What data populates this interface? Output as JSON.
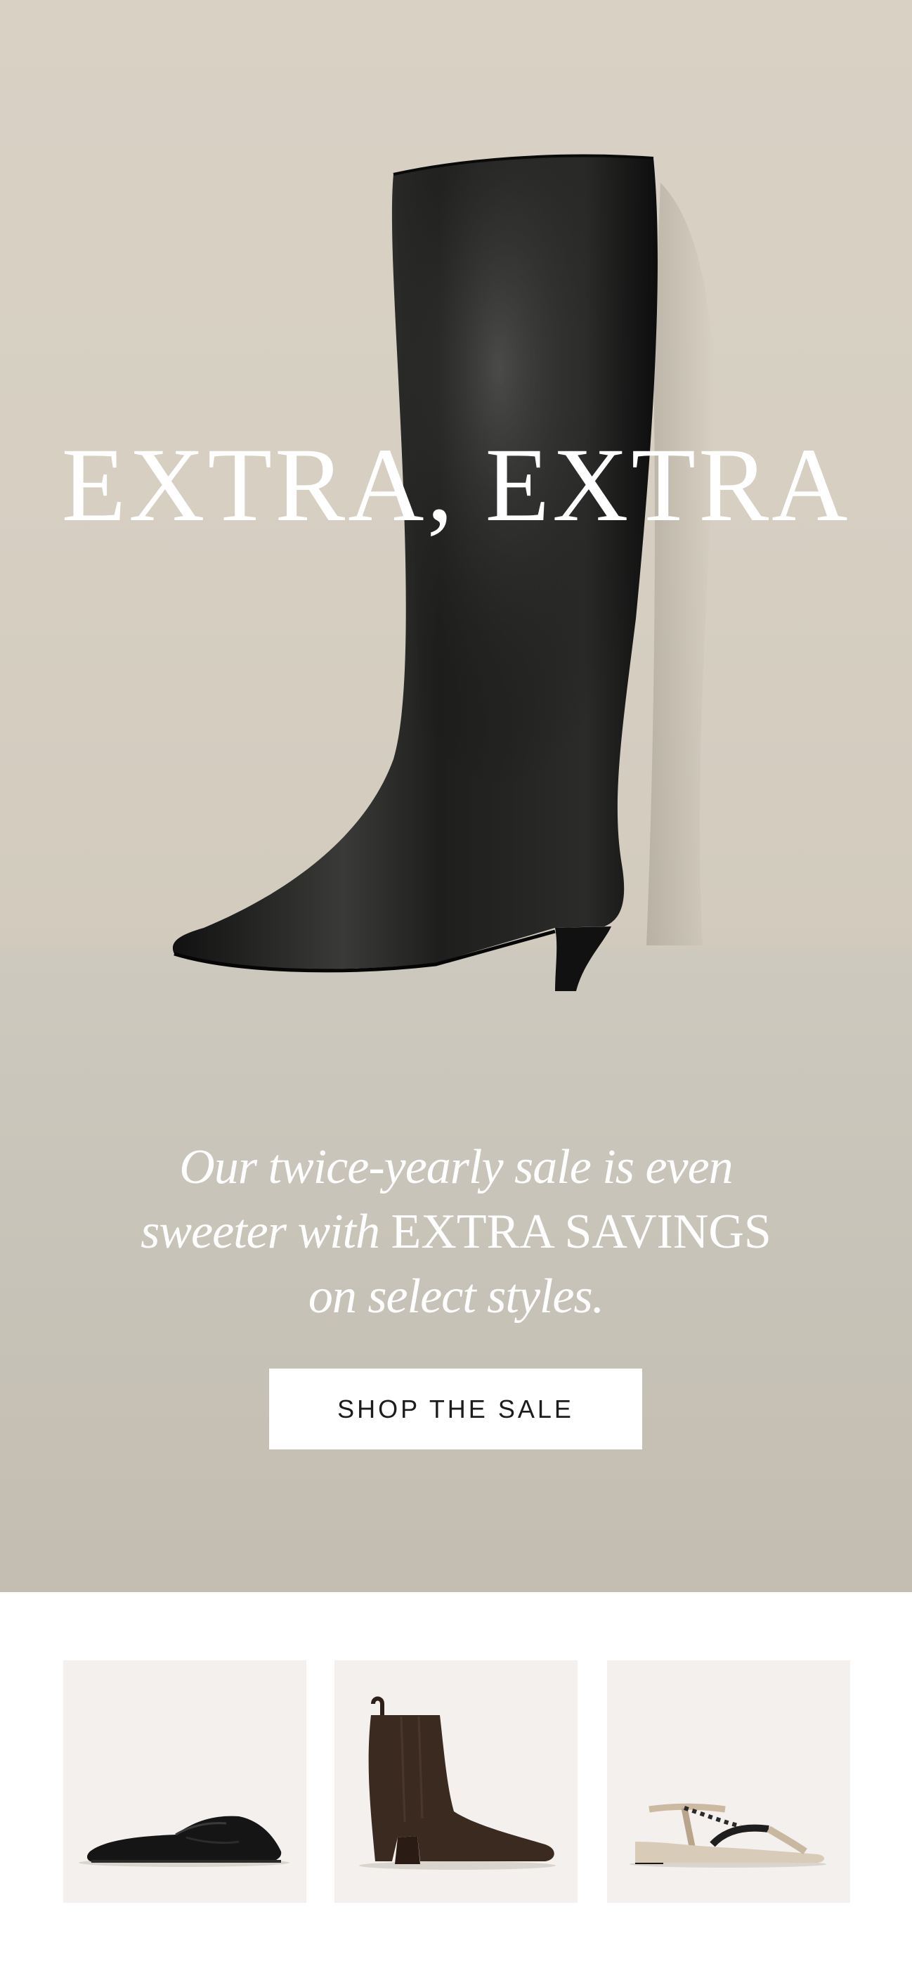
{
  "hero": {
    "headline": "EXTRA, EXTRA",
    "copy": {
      "line1": "Our twice-yearly sale is even",
      "line2_italic": "sweeter with",
      "line2_caps": "EXTRA SAVINGS",
      "line3": "on select styles."
    },
    "cta_label": "SHOP THE SALE"
  },
  "products": [
    {
      "name": "black-loafer-mule",
      "bg": "#f3f0ed"
    },
    {
      "name": "brown-suede-ankle-boot",
      "bg": "#f3f0ed"
    },
    {
      "name": "snake-print-sandal",
      "bg": "#f3f0ed"
    }
  ]
}
